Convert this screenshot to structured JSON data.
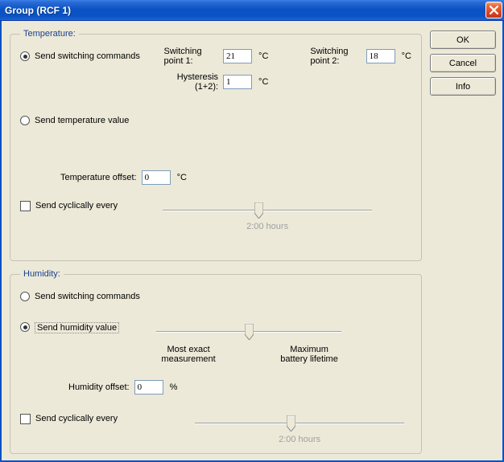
{
  "window": {
    "title": "Group (RCF 1)"
  },
  "buttons": {
    "ok": "OK",
    "cancel": "Cancel",
    "info": "Info"
  },
  "temperature": {
    "legend": "Temperature:",
    "radio_switching": "Send switching commands",
    "radio_value": "Send temperature value",
    "sp1_label": "Switching point 1:",
    "sp1_value": "21",
    "sp1_unit": "°C",
    "sp2_label": "Switching point 2:",
    "sp2_value": "18",
    "sp2_unit": "°C",
    "hyst_label": "Hysteresis (1+2):",
    "hyst_value": "1",
    "hyst_unit": "°C",
    "offset_label": "Temperature offset:",
    "offset_value": "0",
    "offset_unit": "°C",
    "cyclic_label": "Send cyclically every",
    "cyclic_caption": "2:00 hours"
  },
  "humidity": {
    "legend": "Humidity:",
    "radio_switching": "Send switching commands",
    "radio_value": "Send humidity value",
    "slider_left": "Most exact measurement",
    "slider_right": "Maximum battery lifetime",
    "offset_label": "Humidity offset:",
    "offset_value": "0",
    "offset_unit": "%",
    "cyclic_label": "Send cyclically every",
    "cyclic_caption": "2:00 hours"
  }
}
